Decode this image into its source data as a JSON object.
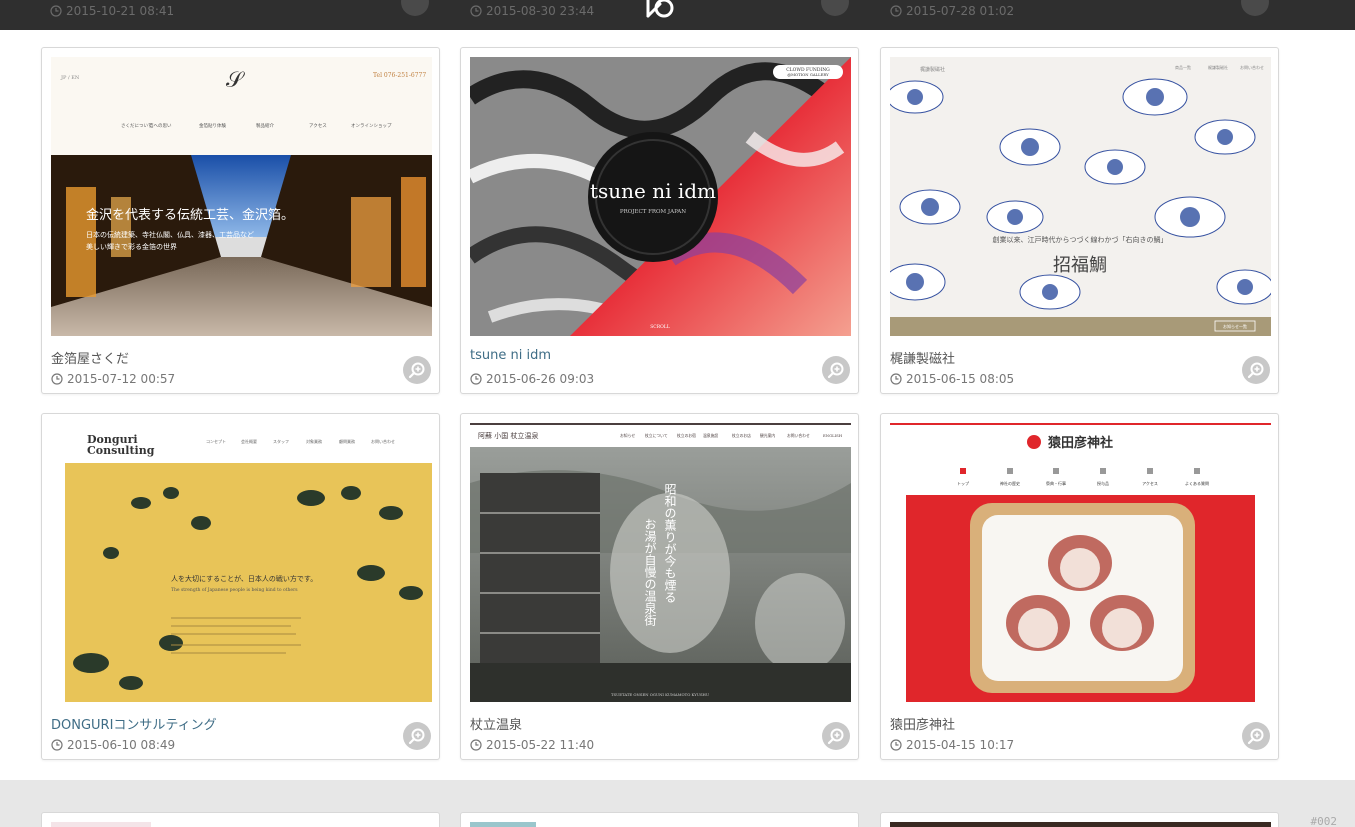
{
  "header": {
    "logo_label": "logo",
    "previous_row_dates": [
      "2015-10-21 08:41",
      "2015-08-30 23:44",
      "2015-07-28 01:02"
    ]
  },
  "cards": [
    {
      "title": "金箔屋さくだ",
      "date": "2015-07-12 00:57",
      "thumb": {
        "nav": [
          "さくだについて",
          "箔への思い",
          "金箔貼り体験",
          "製品紹介",
          "アクセス",
          "オンラインショップ"
        ],
        "tel": "Tel 076-251-6777",
        "headline": "金沢を代表する伝統工芸、金沢箔。",
        "sub": "日本の伝統建築、寺社仏閣、仏具、漆器、工芸品など",
        "sub2": "美しい輝きで彩る金箔の世界",
        "lang": "JP / EN"
      }
    },
    {
      "title": "tsune ni idm",
      "date": "2015-06-26 09:03",
      "thumb": {
        "brand": "tsune ni idm",
        "tagline": "PROJECT FROM JAPAN",
        "badge": "CLOWD FUNDING @MOTION GALLERY",
        "scroll": "SCROLL"
      }
    },
    {
      "title": "梶謙製磁社",
      "date": "2015-06-15 08:05",
      "thumb": {
        "headline": "招福鯛",
        "sub": "創業以来、江戸時代からつづく線わかづ「右向きの鯛」",
        "brand": "梶謙製磁社",
        "nav": [
          "商品一覧",
          "梶謙製磁社",
          "お問い合わせ"
        ],
        "footer_button": "お知らせ一覧"
      }
    },
    {
      "title": "DONGURIコンサルティング",
      "date": "2015-06-10 08:49",
      "thumb": {
        "logo_line1": "Donguri",
        "logo_line2": "Consulting",
        "nav": [
          "コンセプト",
          "会社概要",
          "スタッフ",
          "対象業務",
          "顧問業務",
          "お問い合わせ"
        ],
        "headline": "人を大切にすることが、日本人の戦い方です。",
        "sub": "The strength of Japanese people is being kind to others"
      }
    },
    {
      "title": "杖立温泉",
      "date": "2015-05-22 11:40",
      "thumb": {
        "brand": "阿蘇 小国 杖立温泉",
        "nav": [
          "お知らせ",
          "杖立について",
          "杖立のお宿",
          "温泉施設",
          "杖立のお店",
          "観光案内",
          "お問い合わせ",
          "ENGLISH"
        ],
        "vertical1": "昭和の薫りが今も煙る",
        "vertical2": "お湯が自慢の温泉街",
        "footer": "TSUETATE ONSEN OGUNI KUMAMOTO KYUSHU"
      }
    },
    {
      "title": "猿田彦神社",
      "date": "2015-04-15 10:17",
      "thumb": {
        "brand": "猿田彦神社",
        "nav": [
          "トップ",
          "神社の歴史",
          "祭典・行事",
          "授与品",
          "アクセス",
          "よくある質問"
        ]
      }
    }
  ],
  "page_number": "#002",
  "colors": {
    "header_bg": "#2f2f2f",
    "card_border": "#d8d8d8",
    "link_title": "#3f6d86",
    "zoom_button": "#c8c8c8",
    "shrine_red": "#e0262b",
    "tsuetate_dark": "#4b3f3f"
  },
  "icons": [
    "clock-icon",
    "zoom-in-icon",
    "logo-icon"
  ]
}
